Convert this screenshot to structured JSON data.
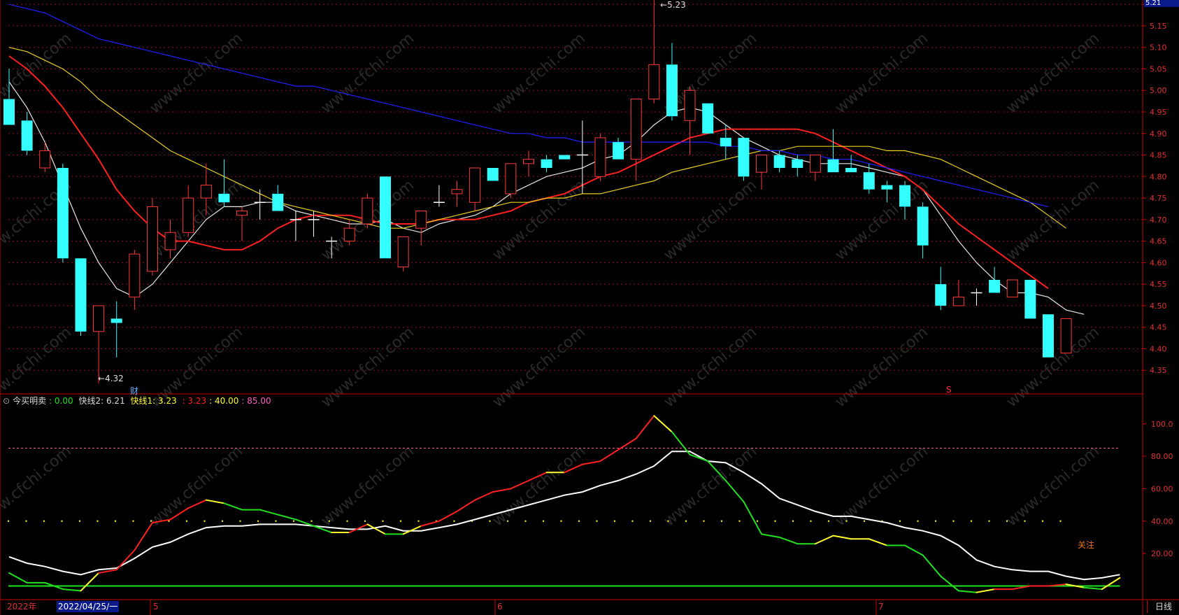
{
  "colors": {
    "background": "#000000",
    "up_candle": "#ff3a3a",
    "down_candle": "#33ffff",
    "ma5": "#e8e8e8",
    "ma10": "#ff2020",
    "ma20": "#e8d020",
    "ma60": "#2020ff",
    "ind_white": "#ffffff",
    "ind_red": "#ff2020",
    "ind_yellow": "#ffff30",
    "ind_green": "#20e020",
    "grid": "#8a1010"
  },
  "header": {
    "indicator_name": "今买明卖",
    "value0": ": 0.00",
    "fast2_label": "快线2: ",
    "fast2_value": "6.21",
    "fast1_label": "快线1: ",
    "fast1_value": "3.23",
    "val3": ": 3.23",
    "val40": ": 40.00",
    "val85": ": 85.00"
  },
  "bottom_bar": {
    "year": "2022年",
    "date": "2022/04/25/一",
    "months": [
      "5",
      "6",
      "7"
    ],
    "period": "日线"
  },
  "price_badge": "5.21",
  "annotations": {
    "high_label": "5.23",
    "low_label": "4.32",
    "cai": "财",
    "s_mark": "S",
    "attention": "关注"
  },
  "chart_data": [
    {
      "type": "candlestick",
      "title": "",
      "ylim": [
        4.3,
        5.21
      ],
      "y_ticks": [
        "5.20",
        "5.15",
        "5.10",
        "5.05",
        "5.00",
        "4.95",
        "4.90",
        "4.85",
        "4.80",
        "4.75",
        "4.70",
        "4.65",
        "4.60",
        "4.55",
        "4.50",
        "4.45",
        "4.40",
        "4.35"
      ],
      "grid": true,
      "watermark": "www.cfchi.com",
      "candles": [
        {
          "o": 4.98,
          "h": 5.05,
          "l": 4.92,
          "c": 4.92
        },
        {
          "o": 4.93,
          "h": 4.95,
          "l": 4.85,
          "c": 4.86
        },
        {
          "o": 4.82,
          "h": 4.88,
          "l": 4.81,
          "c": 4.86
        },
        {
          "o": 4.82,
          "h": 4.83,
          "l": 4.6,
          "c": 4.61
        },
        {
          "o": 4.61,
          "h": 4.61,
          "l": 4.43,
          "c": 4.44
        },
        {
          "o": 4.44,
          "h": 4.5,
          "l": 4.32,
          "c": 4.5
        },
        {
          "o": 4.47,
          "h": 4.51,
          "l": 4.38,
          "c": 4.46
        },
        {
          "o": 4.52,
          "h": 4.63,
          "l": 4.49,
          "c": 4.62
        },
        {
          "o": 4.58,
          "h": 4.75,
          "l": 4.57,
          "c": 4.73
        },
        {
          "o": 4.63,
          "h": 4.7,
          "l": 4.61,
          "c": 4.67
        },
        {
          "o": 4.67,
          "h": 4.78,
          "l": 4.66,
          "c": 4.75
        },
        {
          "o": 4.75,
          "h": 4.83,
          "l": 4.71,
          "c": 4.78
        },
        {
          "o": 4.76,
          "h": 4.84,
          "l": 4.73,
          "c": 4.74
        },
        {
          "o": 4.71,
          "h": 4.73,
          "l": 4.65,
          "c": 4.72
        },
        {
          "o": 4.74,
          "h": 4.77,
          "l": 4.7,
          "c": 4.74
        },
        {
          "o": 4.76,
          "h": 4.78,
          "l": 4.72,
          "c": 4.72
        },
        {
          "o": 4.7,
          "h": 4.72,
          "l": 4.65,
          "c": 4.7
        },
        {
          "o": 4.7,
          "h": 4.72,
          "l": 4.66,
          "c": 4.7
        },
        {
          "o": 4.65,
          "h": 4.66,
          "l": 4.61,
          "c": 4.65
        },
        {
          "o": 4.65,
          "h": 4.7,
          "l": 4.64,
          "c": 4.68
        },
        {
          "o": 4.69,
          "h": 4.76,
          "l": 4.68,
          "c": 4.75
        },
        {
          "o": 4.8,
          "h": 4.8,
          "l": 4.61,
          "c": 4.61
        },
        {
          "o": 4.59,
          "h": 4.66,
          "l": 4.58,
          "c": 4.66
        },
        {
          "o": 4.68,
          "h": 4.72,
          "l": 4.64,
          "c": 4.72
        },
        {
          "o": 4.74,
          "h": 4.78,
          "l": 4.73,
          "c": 4.74
        },
        {
          "o": 4.76,
          "h": 4.79,
          "l": 4.73,
          "c": 4.77
        },
        {
          "o": 4.74,
          "h": 4.82,
          "l": 4.72,
          "c": 4.82
        },
        {
          "o": 4.82,
          "h": 4.82,
          "l": 4.79,
          "c": 4.79
        },
        {
          "o": 4.76,
          "h": 4.83,
          "l": 4.75,
          "c": 4.83
        },
        {
          "o": 4.83,
          "h": 4.86,
          "l": 4.8,
          "c": 4.84
        },
        {
          "o": 4.84,
          "h": 4.85,
          "l": 4.81,
          "c": 4.82
        },
        {
          "o": 4.85,
          "h": 4.85,
          "l": 4.84,
          "c": 4.84
        },
        {
          "o": 4.85,
          "h": 4.93,
          "l": 4.76,
          "c": 4.85
        },
        {
          "o": 4.8,
          "h": 4.9,
          "l": 4.79,
          "c": 4.89
        },
        {
          "o": 4.88,
          "h": 4.89,
          "l": 4.84,
          "c": 4.84
        },
        {
          "o": 4.84,
          "h": 4.98,
          "l": 4.79,
          "c": 4.98
        },
        {
          "o": 4.98,
          "h": 5.23,
          "l": 4.97,
          "c": 5.06
        },
        {
          "o": 5.06,
          "h": 5.11,
          "l": 4.93,
          "c": 4.94
        },
        {
          "o": 4.93,
          "h": 5.01,
          "l": 4.85,
          "c": 5.0
        },
        {
          "o": 4.97,
          "h": 4.97,
          "l": 4.9,
          "c": 4.9
        },
        {
          "o": 4.89,
          "h": 4.92,
          "l": 4.84,
          "c": 4.87
        },
        {
          "o": 4.89,
          "h": 4.89,
          "l": 4.79,
          "c": 4.8
        },
        {
          "o": 4.81,
          "h": 4.85,
          "l": 4.77,
          "c": 4.85
        },
        {
          "o": 4.85,
          "h": 4.86,
          "l": 4.81,
          "c": 4.82
        },
        {
          "o": 4.84,
          "h": 4.85,
          "l": 4.8,
          "c": 4.82
        },
        {
          "o": 4.81,
          "h": 4.85,
          "l": 4.79,
          "c": 4.85
        },
        {
          "o": 4.84,
          "h": 4.91,
          "l": 4.81,
          "c": 4.81
        },
        {
          "o": 4.82,
          "h": 4.85,
          "l": 4.81,
          "c": 4.81
        },
        {
          "o": 4.81,
          "h": 4.83,
          "l": 4.76,
          "c": 4.77
        },
        {
          "o": 4.78,
          "h": 4.79,
          "l": 4.74,
          "c": 4.77
        },
        {
          "o": 4.78,
          "h": 4.79,
          "l": 4.7,
          "c": 4.73
        },
        {
          "o": 4.73,
          "h": 4.74,
          "l": 4.61,
          "c": 4.64
        },
        {
          "o": 4.55,
          "h": 4.59,
          "l": 4.49,
          "c": 4.5
        },
        {
          "o": 4.5,
          "h": 4.56,
          "l": 4.5,
          "c": 4.52
        },
        {
          "o": 4.53,
          "h": 4.54,
          "l": 4.5,
          "c": 4.53
        },
        {
          "o": 4.56,
          "h": 4.59,
          "l": 4.53,
          "c": 4.53
        },
        {
          "o": 4.52,
          "h": 4.56,
          "l": 4.52,
          "c": 4.56
        },
        {
          "o": 4.56,
          "h": 4.56,
          "l": 4.47,
          "c": 4.47
        },
        {
          "o": 4.48,
          "h": 4.48,
          "l": 4.38,
          "c": 4.38
        },
        {
          "o": 4.39,
          "h": 4.47,
          "l": 4.39,
          "c": 4.47
        }
      ],
      "ma_series": [
        {
          "key": "ma5",
          "values": [
            5.02,
            4.96,
            4.88,
            4.78,
            4.68,
            4.6,
            4.54,
            4.52,
            4.55,
            4.6,
            4.65,
            4.7,
            4.73,
            4.73,
            4.74,
            4.74,
            4.72,
            4.71,
            4.7,
            4.69,
            4.69,
            4.7,
            4.68,
            4.67,
            4.69,
            4.7,
            4.71,
            4.73,
            4.76,
            4.78,
            4.8,
            4.81,
            4.82,
            4.84,
            4.85,
            4.88,
            4.92,
            4.95,
            4.96,
            4.95,
            4.92,
            4.89,
            4.87,
            4.85,
            4.84,
            4.83,
            4.83,
            4.83,
            4.82,
            4.81,
            4.8,
            4.77,
            4.71,
            4.65,
            4.6,
            4.56,
            4.53,
            4.53,
            4.52,
            4.49,
            4.48
          ]
        },
        {
          "key": "ma10",
          "values": [
            5.08,
            5.05,
            5.01,
            4.96,
            4.9,
            4.84,
            4.77,
            4.72,
            4.68,
            4.65,
            4.65,
            4.64,
            4.63,
            4.63,
            4.65,
            4.68,
            4.7,
            4.71,
            4.71,
            4.71,
            4.7,
            4.69,
            4.69,
            4.69,
            4.7,
            4.7,
            4.7,
            4.71,
            4.72,
            4.74,
            4.75,
            4.76,
            4.78,
            4.8,
            4.81,
            4.83,
            4.85,
            4.87,
            4.89,
            4.9,
            4.91,
            4.91,
            4.91,
            4.91,
            4.91,
            4.9,
            4.88,
            4.86,
            4.84,
            4.82,
            4.8,
            4.77,
            4.73,
            4.69,
            4.66,
            4.63,
            4.6,
            4.57,
            4.54
          ]
        },
        {
          "key": "ma20",
          "values": [
            5.1,
            5.09,
            5.07,
            5.05,
            5.02,
            4.98,
            4.95,
            4.92,
            4.89,
            4.86,
            4.84,
            4.82,
            4.8,
            4.78,
            4.76,
            4.74,
            4.73,
            4.72,
            4.71,
            4.7,
            4.69,
            4.68,
            4.68,
            4.69,
            4.7,
            4.71,
            4.72,
            4.73,
            4.74,
            4.74,
            4.75,
            4.75,
            4.76,
            4.76,
            4.77,
            4.78,
            4.79,
            4.81,
            4.82,
            4.83,
            4.84,
            4.85,
            4.86,
            4.86,
            4.87,
            4.87,
            4.87,
            4.87,
            4.87,
            4.86,
            4.86,
            4.85,
            4.84,
            4.82,
            4.8,
            4.78,
            4.76,
            4.74,
            4.71,
            4.68
          ]
        },
        {
          "key": "ma60",
          "values": [
            5.2,
            5.19,
            5.18,
            5.16,
            5.14,
            5.12,
            5.11,
            5.1,
            5.09,
            5.08,
            5.07,
            5.06,
            5.05,
            5.04,
            5.03,
            5.02,
            5.01,
            5.01,
            5.0,
            4.99,
            4.98,
            4.97,
            4.96,
            4.95,
            4.94,
            4.93,
            4.92,
            4.91,
            4.9,
            4.9,
            4.89,
            4.89,
            4.88,
            4.88,
            4.88,
            4.88,
            4.88,
            4.88,
            4.88,
            4.88,
            4.87,
            4.87,
            4.86,
            4.86,
            4.85,
            4.85,
            4.84,
            4.84,
            4.83,
            4.82,
            4.81,
            4.8,
            4.79,
            4.78,
            4.77,
            4.76,
            4.75,
            4.74,
            4.73
          ]
        }
      ]
    },
    {
      "type": "line",
      "title": "今买明卖",
      "ylim": [
        -8,
        112
      ],
      "y_ticks": [
        "100.0",
        "80.00",
        "60.00",
        "40.00",
        "20.00"
      ],
      "ref_lines": [
        85,
        40,
        0
      ],
      "series": [
        {
          "key": "white",
          "values": [
            18,
            14,
            12,
            9,
            7,
            10,
            11,
            17,
            24,
            27,
            32,
            36,
            37,
            37,
            38,
            38,
            38,
            37,
            36,
            35,
            35,
            37,
            34,
            34,
            36,
            38,
            41,
            44,
            47,
            50,
            53,
            56,
            58,
            62,
            65,
            69,
            74,
            83,
            83,
            77,
            76,
            70,
            63,
            54,
            50,
            46,
            43,
            43,
            41,
            39,
            36,
            34,
            31,
            25,
            16,
            12,
            10,
            9,
            9,
            6,
            4,
            5,
            7
          ]
        },
        {
          "key": "fast",
          "values": [
            8,
            2,
            2,
            -2,
            -3,
            8,
            10,
            22,
            39,
            41,
            48,
            53,
            51,
            47,
            47,
            44,
            41,
            37,
            33,
            33,
            38,
            32,
            32,
            37,
            40,
            46,
            53,
            58,
            60,
            65,
            70,
            70,
            75,
            77,
            84,
            91,
            105,
            95,
            81,
            77,
            65,
            52,
            32,
            30,
            26,
            26,
            31,
            29,
            29,
            25,
            25,
            19,
            6,
            -3,
            -4,
            -2,
            -2,
            0,
            0,
            1,
            -1,
            -2,
            5
          ]
        }
      ],
      "segment_colors": [
        "green",
        "green",
        "green",
        "green",
        "yellow",
        "red",
        "red",
        "red",
        "red",
        "red",
        "red",
        "yellow",
        "green",
        "green",
        "green",
        "green",
        "green",
        "green",
        "yellow",
        "red",
        "yellow",
        "green",
        "yellow",
        "red",
        "red",
        "red",
        "red",
        "red",
        "red",
        "red",
        "yellow",
        "red",
        "red",
        "red",
        "red",
        "red",
        "yellow",
        "green",
        "green",
        "green",
        "green",
        "green",
        "green",
        "green",
        "green",
        "yellow",
        "yellow",
        "yellow",
        "yellow",
        "green",
        "green",
        "green",
        "green",
        "green",
        "yellow",
        "red",
        "red",
        "red",
        "red",
        "yellow",
        "green",
        "yellow"
      ]
    }
  ]
}
